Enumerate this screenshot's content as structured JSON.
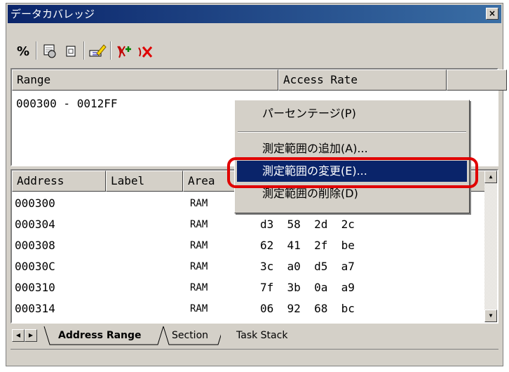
{
  "window": {
    "title": "データカバレッジ",
    "close_glyph": "×"
  },
  "toolbar": [
    {
      "icon": "percent-icon",
      "glyph": "%"
    },
    {
      "icon": "range-settings-icon"
    },
    {
      "icon": "document-icon"
    },
    {
      "icon": "highlighter-icon"
    },
    {
      "icon": "add-range-icon"
    },
    {
      "icon": "delete-range-icon"
    }
  ],
  "range_pane": {
    "columns": [
      "Range",
      "Access Rate"
    ],
    "rows": [
      {
        "range": "000300 - 0012FF",
        "rate": ""
      }
    ]
  },
  "data_pane": {
    "columns": [
      "Address",
      "Label",
      "Area"
    ],
    "rows": [
      {
        "address": "000300",
        "label": "",
        "area": "RAM",
        "data": ""
      },
      {
        "address": "000304",
        "label": "",
        "area": "RAM",
        "data": "d3  58  2d  2c"
      },
      {
        "address": "000308",
        "label": "",
        "area": "RAM",
        "data": "62  41  2f  be"
      },
      {
        "address": "00030C",
        "label": "",
        "area": "RAM",
        "data": "3c  a0  d5  a7"
      },
      {
        "address": "000310",
        "label": "",
        "area": "RAM",
        "data": "7f  3b  0a  a9"
      },
      {
        "address": "000314",
        "label": "",
        "area": "RAM",
        "data": "06  92  68  bc"
      }
    ]
  },
  "tabs": [
    "Address Range",
    "Section",
    "Task Stack"
  ],
  "context_menu": {
    "items": [
      "パーセンテージ(P)",
      "測定範囲の追加(A)...",
      "測定範囲の変更(E)...",
      "測定範囲の削除(D)"
    ],
    "selected": "測定範囲の変更(E)..."
  },
  "colors": {
    "selection": "#0a246a",
    "highlight_outline": "#e00000",
    "titlebar": "#0a246a"
  }
}
